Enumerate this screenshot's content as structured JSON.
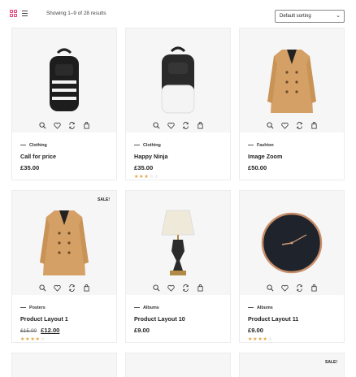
{
  "toolbar": {
    "result_count": "Showing 1–9 of 28 results",
    "sort_selected": "Default sorting",
    "view_grid_icon": "grid-view-icon",
    "view_list_icon": "list-view-icon"
  },
  "colors": {
    "accent": "#e2336b",
    "star": "#e0a03a"
  },
  "products": [
    {
      "category": "Clothing",
      "title": "Call for price",
      "price": "£35.00",
      "rating": 0,
      "image": "backpack-striped"
    },
    {
      "category": "Clothing",
      "title": "Happy Ninja",
      "price": "£35.00",
      "rating": 3,
      "image": "backpack-white"
    },
    {
      "category": "Fashion",
      "title": "Image Zoom",
      "price": "£50.00",
      "rating": 0,
      "image": "trench-coat"
    },
    {
      "category": "Posters",
      "title": "Product Layout 1",
      "old_price": "£15.00",
      "price": "£12.00",
      "rating": 4,
      "badge": "SALE!",
      "image": "trench-coat"
    },
    {
      "category": "Albums",
      "title": "Product Layout 10",
      "price": "£9.00",
      "rating": 0,
      "image": "table-lamp"
    },
    {
      "category": "Albums",
      "title": "Product Layout 11",
      "price": "£9.00",
      "rating": 4,
      "image": "wall-clock"
    }
  ],
  "partial_row": {
    "badge": "SALE!"
  },
  "card_icons": [
    "search-icon",
    "heart-icon",
    "compare-icon",
    "cart-icon"
  ]
}
